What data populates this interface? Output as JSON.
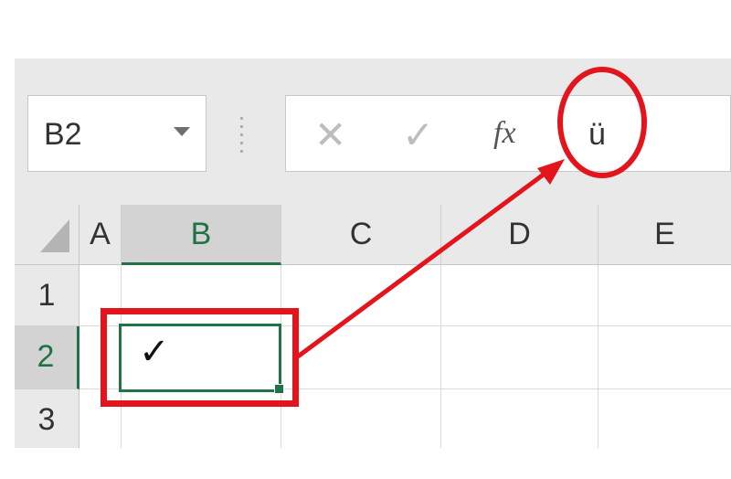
{
  "name_box": {
    "value": "B2"
  },
  "formula_bar": {
    "cancel_symbol": "✕",
    "enter_symbol": "✓",
    "fx_label": "fx",
    "content": "ü"
  },
  "columns": [
    "A",
    "B",
    "C",
    "D",
    "E"
  ],
  "rows": [
    "1",
    "2",
    "3"
  ],
  "selected_cell": {
    "ref": "B2",
    "value": "✓"
  },
  "annotation_color": "#e3141b",
  "accent_color": "#217346"
}
